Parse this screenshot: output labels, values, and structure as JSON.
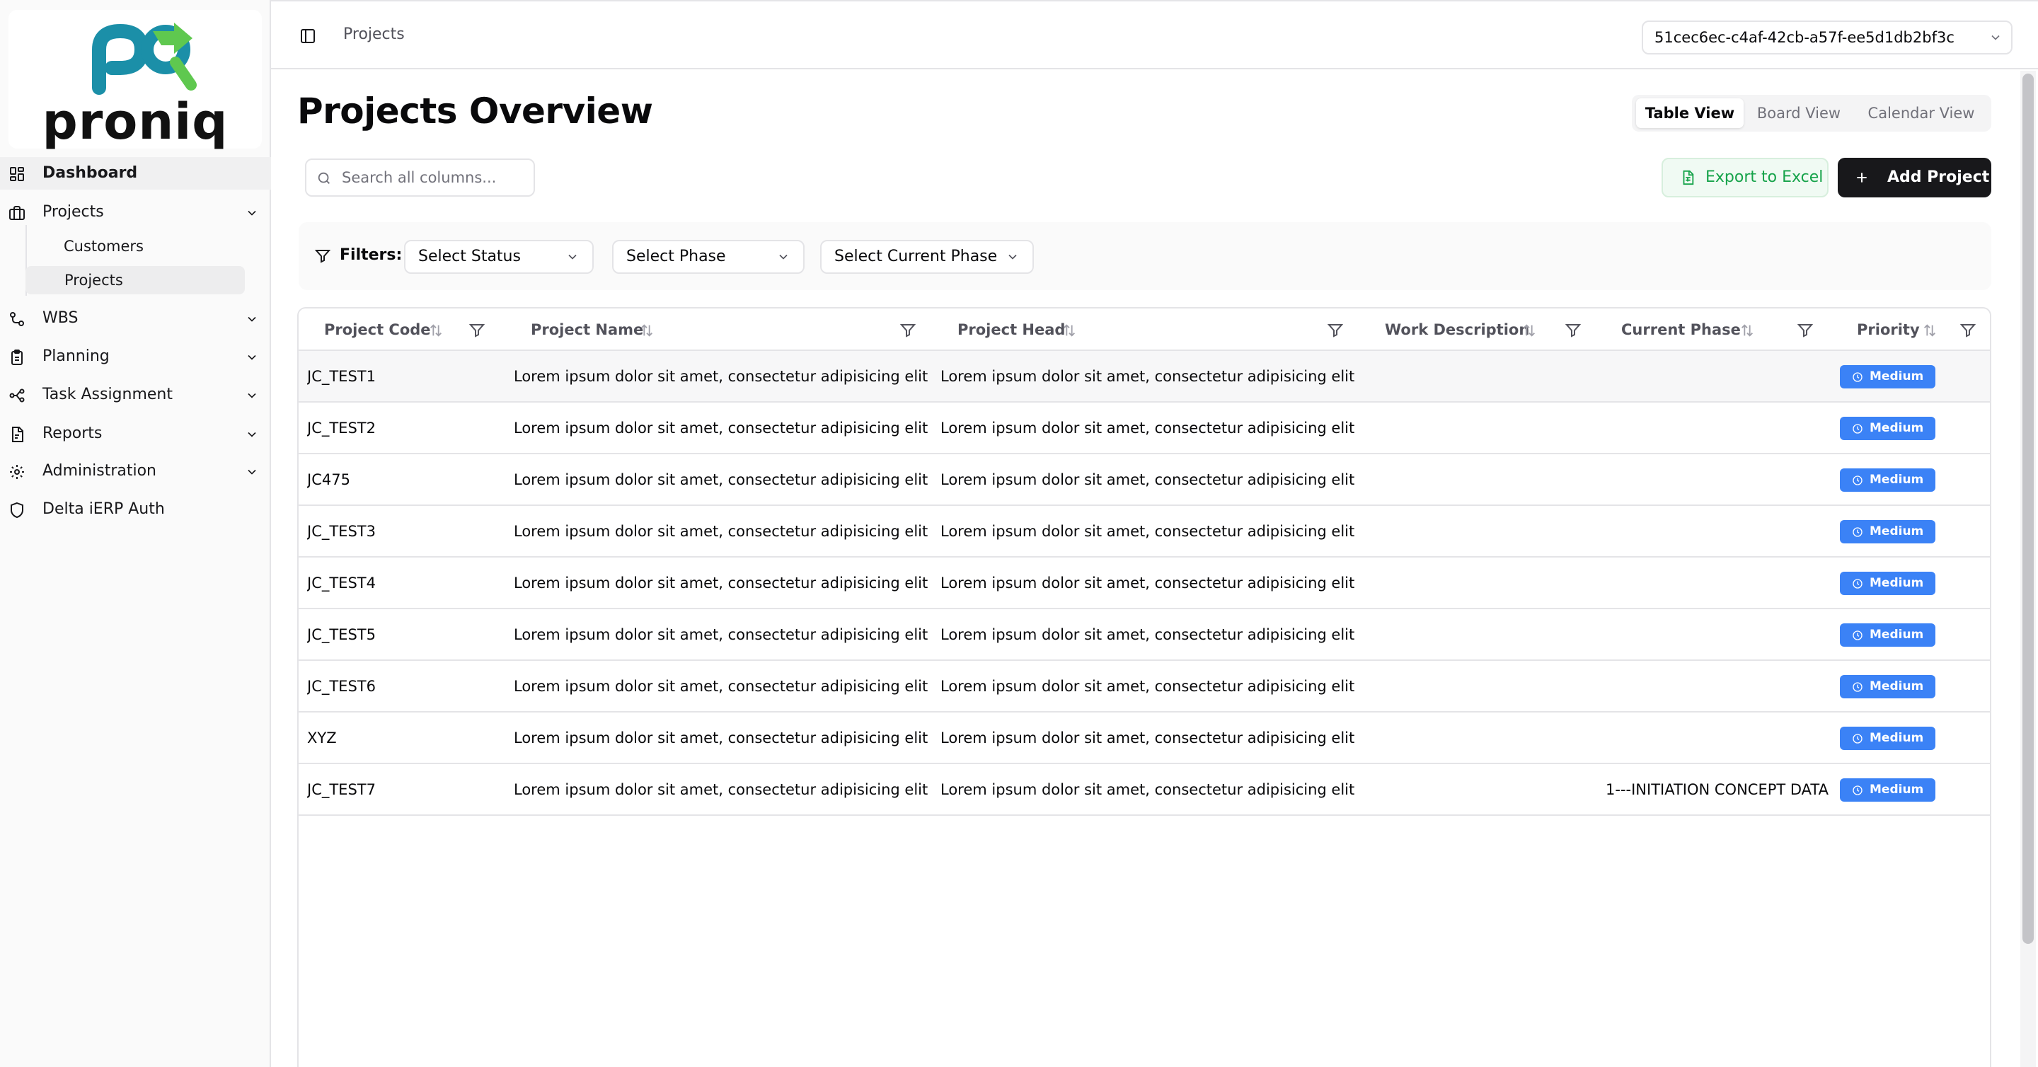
{
  "brand": {
    "name": "proniq"
  },
  "sidebar": {
    "items": [
      {
        "label": "Dashboard",
        "icon": "grid-icon"
      },
      {
        "label": "Projects",
        "icon": "briefcase-icon"
      },
      {
        "label": "WBS",
        "icon": "network-icon"
      },
      {
        "label": "Planning",
        "icon": "clipboard-icon"
      },
      {
        "label": "Task Assignment",
        "icon": "workflow-icon"
      },
      {
        "label": "Reports",
        "icon": "report-icon"
      },
      {
        "label": "Administration",
        "icon": "gear-icon"
      },
      {
        "label": "Delta iERP Auth",
        "icon": "shield-icon"
      }
    ],
    "sub_items": [
      {
        "label": "Customers"
      },
      {
        "label": "Projects"
      }
    ]
  },
  "header": {
    "breadcrumb": "Projects",
    "workspace_id": "51cec6ec-c4af-42cb-a57f-ee5d1db2bf3c"
  },
  "main": {
    "title": "Projects Overview",
    "view_tabs": [
      "Table View",
      "Board View",
      "Calendar View"
    ],
    "active_view": "Table View",
    "search_placeholder": "Search all columns...",
    "export_label": "Export to Excel",
    "add_label": "Add Project",
    "filters": {
      "label": "Filters:",
      "selects": [
        "Select Status",
        "Select Phase",
        "Select Current Phase"
      ]
    }
  },
  "table": {
    "columns": [
      "Project Code",
      "Project Name",
      "Project Head",
      "Work Description",
      "Current Phase",
      "Priority"
    ],
    "rows": [
      {
        "code": "JC_TEST1",
        "name": "Lorem ipsum dolor sit amet, consectetur adipisicing elit",
        "head": "Lorem ipsum dolor sit amet, consectetur adipisicing elit",
        "description": "",
        "phase": "",
        "priority": "Medium"
      },
      {
        "code": "JC_TEST2",
        "name": "Lorem ipsum dolor sit amet, consectetur adipisicing elit",
        "head": "Lorem ipsum dolor sit amet, consectetur adipisicing elit",
        "description": "",
        "phase": "",
        "priority": "Medium"
      },
      {
        "code": "JC475",
        "name": "Lorem ipsum dolor sit amet, consectetur adipisicing elit",
        "head": "Lorem ipsum dolor sit amet, consectetur adipisicing elit",
        "description": "",
        "phase": "",
        "priority": "Medium"
      },
      {
        "code": "JC_TEST3",
        "name": "Lorem ipsum dolor sit amet, consectetur adipisicing elit",
        "head": "Lorem ipsum dolor sit amet, consectetur adipisicing elit",
        "description": "",
        "phase": "",
        "priority": "Medium"
      },
      {
        "code": "JC_TEST4",
        "name": "Lorem ipsum dolor sit amet, consectetur adipisicing elit",
        "head": "Lorem ipsum dolor sit amet, consectetur adipisicing elit",
        "description": "",
        "phase": "",
        "priority": "Medium"
      },
      {
        "code": "JC_TEST5",
        "name": "Lorem ipsum dolor sit amet, consectetur adipisicing elit",
        "head": "Lorem ipsum dolor sit amet, consectetur adipisicing elit",
        "description": "",
        "phase": "",
        "priority": "Medium"
      },
      {
        "code": "JC_TEST6",
        "name": "Lorem ipsum dolor sit amet, consectetur adipisicing elit",
        "head": "Lorem ipsum dolor sit amet, consectetur adipisicing elit",
        "description": "",
        "phase": "",
        "priority": "Medium"
      },
      {
        "code": "XYZ",
        "name": "Lorem ipsum dolor sit amet, consectetur adipisicing elit",
        "head": "Lorem ipsum dolor sit amet, consectetur adipisicing elit",
        "description": "",
        "phase": "",
        "priority": "Medium"
      },
      {
        "code": "JC_TEST7",
        "name": "Lorem ipsum dolor sit amet, consectetur adipisicing elit",
        "head": "Lorem ipsum dolor sit amet, consectetur adipisicing elit",
        "description": "",
        "phase": "1---INITIATION CONCEPT DATA",
        "priority": "Medium"
      }
    ]
  },
  "colors": {
    "accent": "#18181b",
    "priority_medium": "#3b82f6",
    "export_green": "#16a34a",
    "logo_teal": "#1b8fa8",
    "logo_green": "#5fc84f"
  }
}
